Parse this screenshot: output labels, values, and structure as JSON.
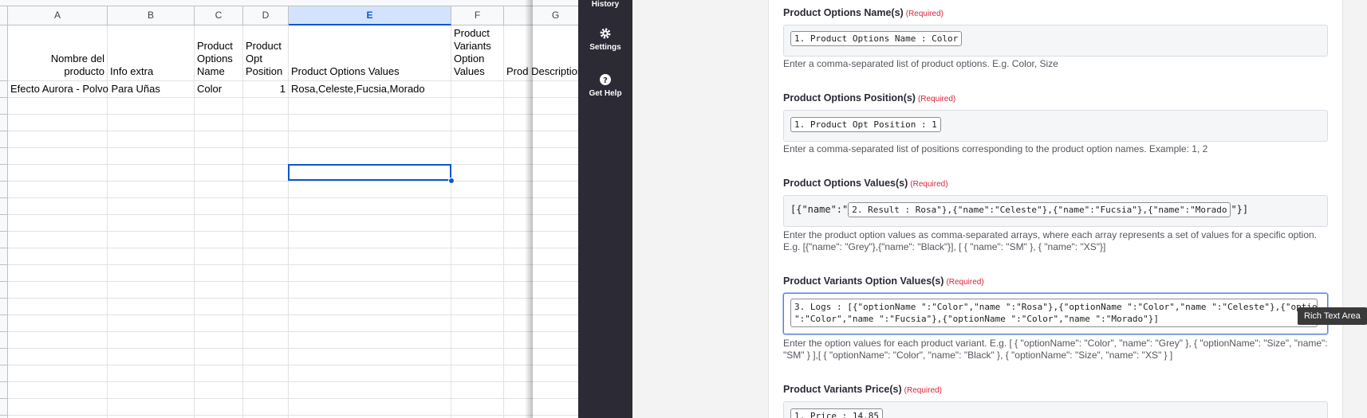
{
  "sheet": {
    "columns": [
      "A",
      "B",
      "C",
      "D",
      "E",
      "F",
      "G"
    ],
    "selected_column": "E",
    "headers": {
      "A": "Nombre del producto",
      "B": "Info extra",
      "C": "Product Options Name",
      "D": "Product Opt Position",
      "E": "Product Options Values",
      "F": "Product Variants Option Values",
      "G": "Prod Description"
    },
    "row1": {
      "A": "Efecto Aurora - Polvo Para Uñas",
      "B": "",
      "C": "Color",
      "D": "1",
      "E": "Rosa,Celeste,Fucsia,Morado",
      "F": "",
      "G": ""
    }
  },
  "sidebar": {
    "items": [
      {
        "label": "History",
        "icon": "history-icon"
      },
      {
        "label": "Settings",
        "icon": "gear-icon"
      },
      {
        "label": "Get Help",
        "icon": "help-icon"
      }
    ]
  },
  "form": {
    "required_label": "(Required)",
    "fields": [
      {
        "label": "Product Options Name(s)",
        "pills": [
          "1. Product Options Name : Color"
        ],
        "help": "Enter a comma-separated list of product options. E.g. Color, Size"
      },
      {
        "label": "Product Options Position(s)",
        "pills": [
          "1. Product Opt Position : 1"
        ],
        "help": "Enter a comma-separated list of positions corresponding to the product option names. Example: 1, 2"
      },
      {
        "label": "Product Options Values(s)",
        "prefix": "[{\"name\":\"",
        "pill": "2. Result : Rosa\"},{\"name\":\"Celeste\"},{\"name\":\"Fucsia\"},{\"name\":\"Morado",
        "suffix": "\"}]",
        "help": "Enter the product option values as comma-separated arrays, where each array represents a set of values for a specific option. E.g. [{\"name\": \"Grey\"},{\"name\": \"Black\"}], [ { \"name\": \"SM\" }, { \"name\": \"XS\"}]"
      },
      {
        "label": "Product Variants Option Values(s)",
        "pill_line1": "3. Logs : [{\"optionName \":\"Color\",\"name \":\"Rosa\"},{\"optionName \":\"Color\",\"name \":\"Celeste\"},{\"optionName",
        "pill_line2": "\":\"Color\",\"name \":\"Fucsia\"},{\"optionName \":\"Color\",\"name \":\"Morado\"}]",
        "help": "Enter the option values for each product variant. E.g. [ { \"optionName\": \"Color\", \"name\": \"Grey\" }, { \"optionName\": \"Size\", \"name\": \"SM\" } ],[ { \"optionName\": \"Color\", \"name\": \"Black\" }, { \"optionName\": \"Size\", \"name\": \"XS\" } ]"
      },
      {
        "label": "Product Variants Price(s)",
        "pills": [
          "1. Price : 14.85"
        ]
      }
    ]
  },
  "tooltip": "Rich Text Area",
  "colors": {
    "sidebar_bg": "#2b2a35",
    "required": "#d9243a",
    "selection": "#0b57d0"
  }
}
